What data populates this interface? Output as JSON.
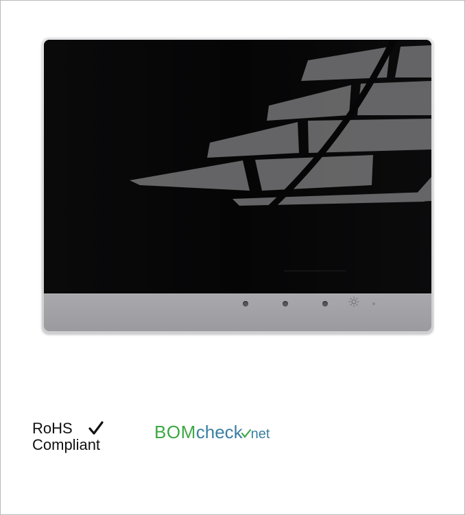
{
  "badges": {
    "rohs_line1": "RoHS",
    "rohs_line2": "Compliant",
    "bom_part1": "BOM",
    "bom_part2": "check",
    "bom_part3": "net"
  },
  "colors": {
    "screen": "#040405",
    "bezel": "#a3a3a7",
    "bom_green": "#3da844",
    "bom_blue": "#3a7fa4"
  },
  "icons": [
    "check-icon",
    "sun-icon"
  ]
}
